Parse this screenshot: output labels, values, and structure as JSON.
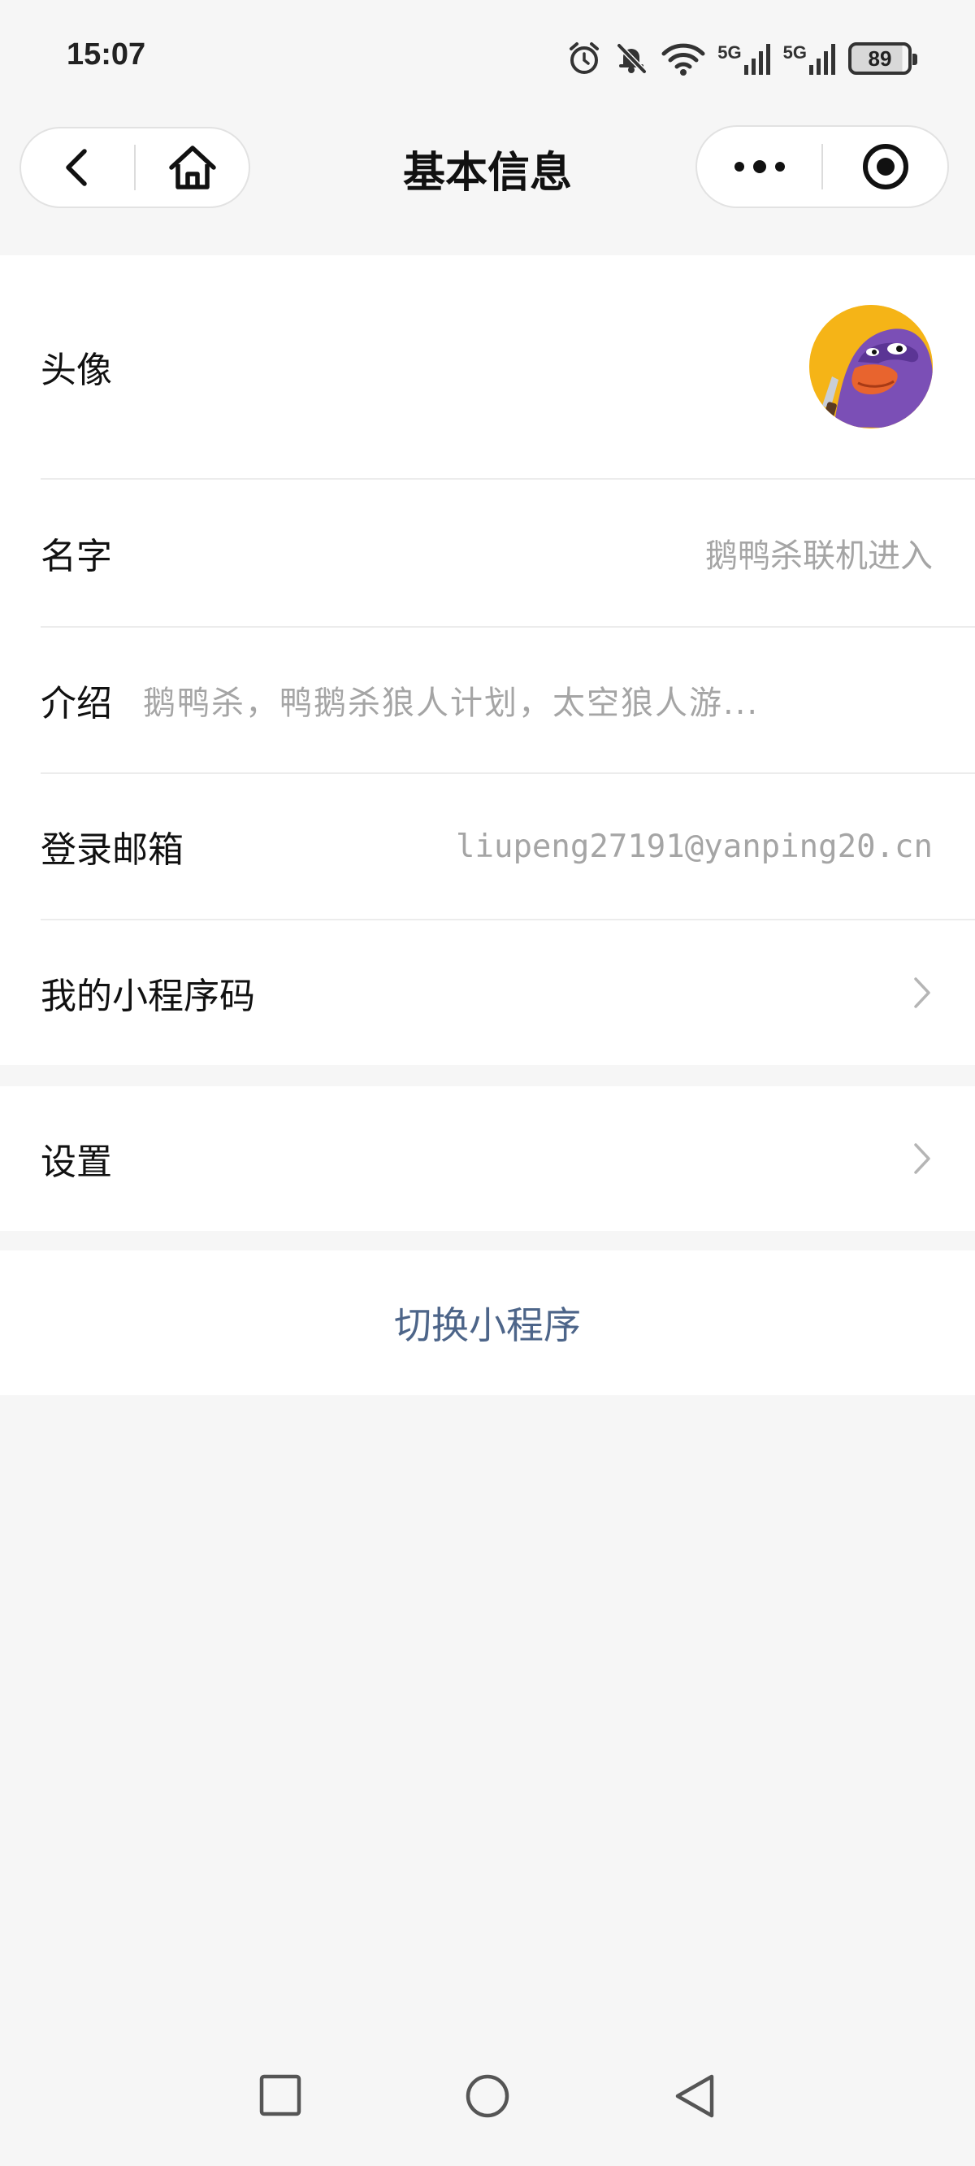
{
  "status_bar": {
    "time": "15:07",
    "network_1": "5G",
    "network_2": "5G",
    "battery": "89"
  },
  "header": {
    "title": "基本信息",
    "icons": [
      "back-icon",
      "home-icon",
      "more-icon",
      "close-target-icon"
    ]
  },
  "profile": {
    "avatar_label": "头像",
    "name_label": "名字",
    "name_value": "鹅鸭杀联机进入",
    "intro_label": "介绍",
    "intro_value": "鹅鸭杀，鸭鹅杀狼人计划，太空狼人游...",
    "email_label": "登录邮箱",
    "email_value": "liupeng27191@yanping20.cn",
    "qrcode_label": "我的小程序码"
  },
  "settings": {
    "label": "设置"
  },
  "switch": {
    "label": "切换小程序"
  },
  "colors": {
    "background": "#f6f6f6",
    "card": "#ffffff",
    "link": "#4d6589",
    "secondary_text": "#a5a5a5"
  }
}
